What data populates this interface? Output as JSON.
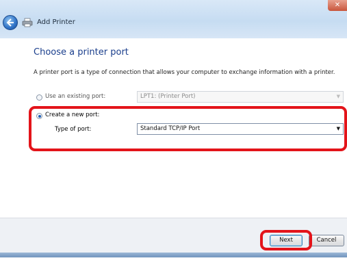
{
  "window": {
    "title": "Add Printer",
    "close_label": "✕"
  },
  "content": {
    "heading": "Choose a printer port",
    "description": "A printer port is a type of connection that allows your computer to exchange information with a printer."
  },
  "options": {
    "existing": {
      "label": "Use an existing port:",
      "value": "LPT1: (Printer Port)",
      "selected": false,
      "enabled": false
    },
    "new": {
      "label": "Create a new port:",
      "selected": true,
      "type_label": "Type of port:",
      "type_value": "Standard TCP/IP Port"
    }
  },
  "buttons": {
    "next": "Next",
    "cancel": "Cancel"
  },
  "colors": {
    "heading": "#1a3e8c",
    "highlight": "#e3141a"
  },
  "icons": {
    "back": "back-arrow-icon",
    "printer": "printer-icon",
    "dropdown": "chevron-down-icon"
  }
}
